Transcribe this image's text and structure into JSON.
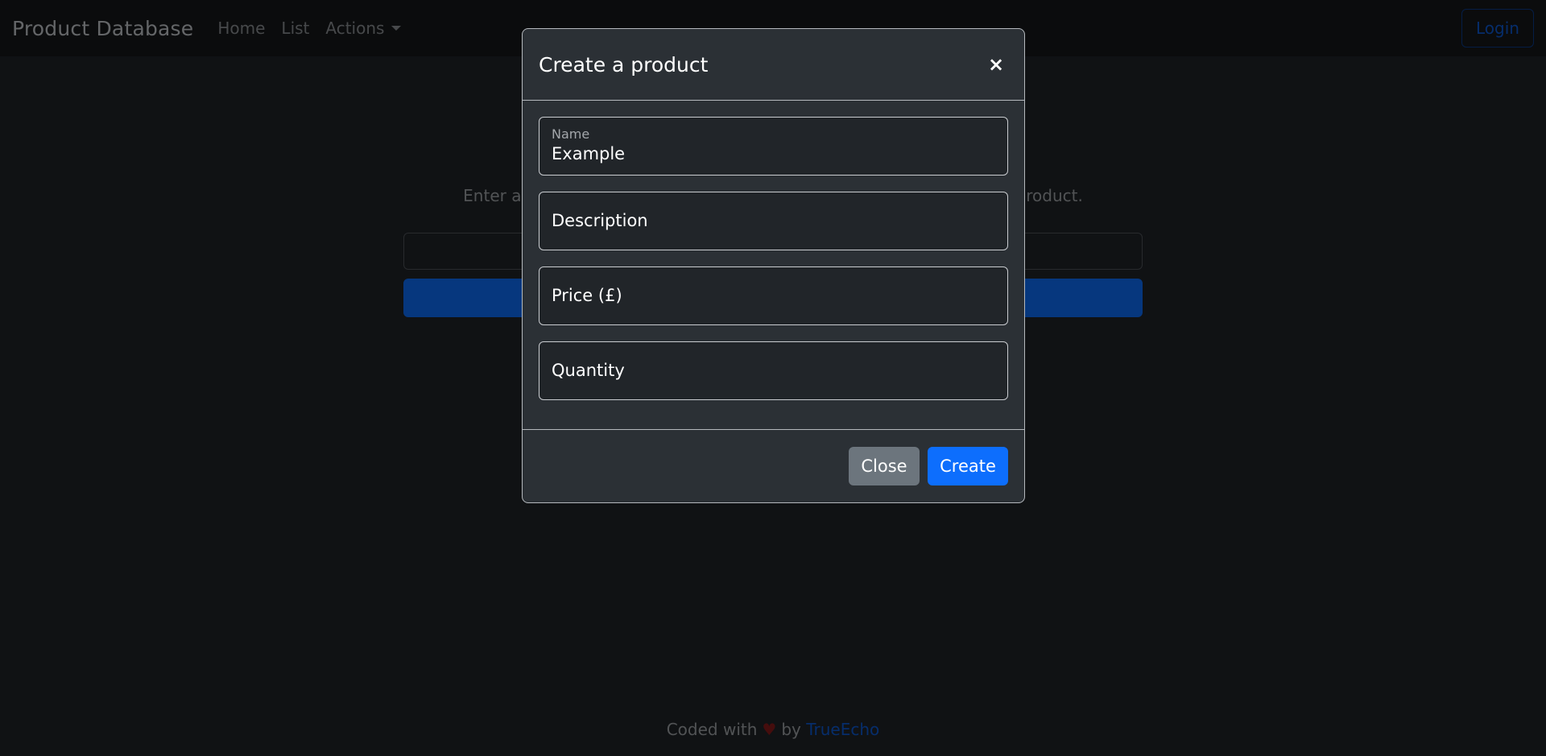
{
  "navbar": {
    "brand": "Product Database",
    "links": [
      "Home",
      "List",
      "Actions"
    ],
    "login_label": "Login"
  },
  "main": {
    "prompt_left": "Enter a p",
    "prompt_right": "product."
  },
  "footer": {
    "text_before": "Coded with",
    "heart": "♥",
    "text_by": "by",
    "author": "TrueEcho"
  },
  "modal": {
    "title": "Create a product",
    "close_icon": "×",
    "fields": {
      "name": {
        "label": "Name",
        "value": "Example"
      },
      "description": {
        "label": "Description"
      },
      "price": {
        "label": "Price (£)"
      },
      "quantity": {
        "label": "Quantity"
      }
    },
    "close_label": "Close",
    "create_label": "Create"
  },
  "colors": {
    "primary": "#0d6efd",
    "secondary": "#6c757d",
    "background": "#212529",
    "navbar": "#16181b"
  }
}
